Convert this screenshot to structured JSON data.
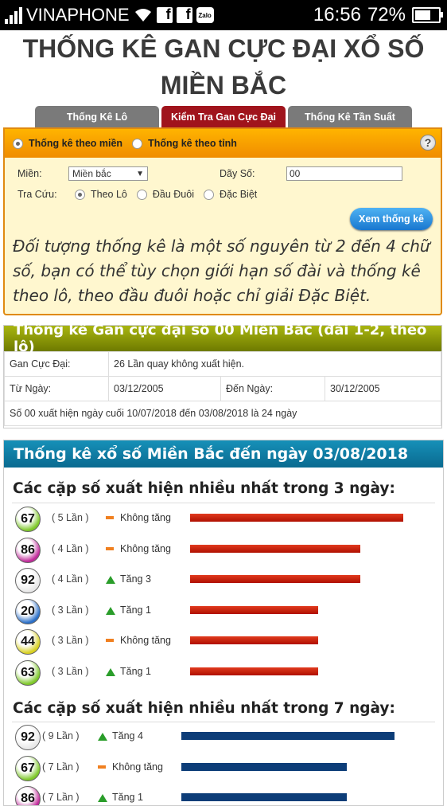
{
  "status": {
    "carrier": "VINAPHONE",
    "time": "16:56",
    "battery": "72%",
    "battery_level": 0.72,
    "icons": [
      "signal-icon",
      "wifi-icon",
      "facebook-icon",
      "facebook-icon",
      "zalo-icon",
      "battery-icon"
    ],
    "fb": "f",
    "zalo": "Zalo"
  },
  "page": {
    "title": "THỐNG KÊ GAN CỰC ĐẠI XỔ SỐ MIỀN BẮC"
  },
  "tabs": [
    {
      "label": "Thống Kê Lô"
    },
    {
      "label": "Kiểm Tra Gan Cực Đại"
    },
    {
      "label": "Thống Kê Tần Suất"
    }
  ],
  "form": {
    "mode_region": "Thống kê theo miền",
    "mode_province": "Thống kê theo tỉnh",
    "help": "?",
    "mien_label": "Miền:",
    "mien_value": "Miền bắc",
    "dayso_label": "Dãy Số:",
    "dayso_value": "00",
    "tracuu_label": "Tra Cứu:",
    "opt_lo": "Theo Lô",
    "opt_dau": "Đầu Đuôi",
    "opt_db": "Đặc Biệt",
    "view_button": "Xem thống kê",
    "description": "Đối tượng thống kê là một số nguyên từ 2 đến 4 chữ số, bạn có thể tùy chọn giới hạn số đài và thống kê theo lô, theo đầu đuôi hoặc chỉ giải Đặc Biệt."
  },
  "gan": {
    "title": "Thống kê Gan cực đại số 00 Miền Bắc (đài 1-2, theo lô)",
    "max_label": "Gan Cực Đại:",
    "max_value": "26 Lần quay không xuất hiện.",
    "from_label": "Từ Ngày:",
    "from_value": "03/12/2005",
    "to_label": "Đến Ngày:",
    "to_value": "30/12/2005",
    "note": "Số 00 xuất hiện ngày cuối 10/07/2018 đến 03/08/2018 là 24 ngày"
  },
  "stats": {
    "title": "Thống kê xổ số Miền Bắc đến ngày 03/08/2018",
    "sec3_title": "Các cặp số xuất hiện nhiều nhất trong 3 ngày:",
    "sec3": [
      {
        "num": "67",
        "count": "( 5 Lần )",
        "count_value": 5,
        "trend": "Không tăng",
        "dir": "flat",
        "color": "#7ec82a"
      },
      {
        "num": "86",
        "count": "( 4 Lần )",
        "count_value": 4,
        "trend": "Không tăng",
        "dir": "flat",
        "color": "#c02a9a"
      },
      {
        "num": "92",
        "count": "( 4 Lần )",
        "count_value": 4,
        "trend": "Tăng 3",
        "dir": "up",
        "color": "#e8e8e8"
      },
      {
        "num": "20",
        "count": "( 3 Lần )",
        "count_value": 3,
        "trend": "Tăng 1",
        "dir": "up",
        "color": "#2a6fc8"
      },
      {
        "num": "44",
        "count": "( 3 Lần )",
        "count_value": 3,
        "trend": "Không tăng",
        "dir": "flat",
        "color": "#d8d020"
      },
      {
        "num": "63",
        "count": "( 3 Lần )",
        "count_value": 3,
        "trend": "Tăng 1",
        "dir": "up",
        "color": "#7ec82a"
      }
    ],
    "sec7_title": "Các cặp số xuất hiện nhiều nhất trong 7 ngày:",
    "sec7": [
      {
        "num": "92",
        "count": "( 9 Lần )",
        "count_value": 9,
        "trend": "Tăng 4",
        "dir": "up",
        "color": "#e8e8e8"
      },
      {
        "num": "67",
        "count": "( 7 Lần )",
        "count_value": 7,
        "trend": "Không tăng",
        "dir": "flat",
        "color": "#7ec82a"
      },
      {
        "num": "86",
        "count": "( 7 Lần )",
        "count_value": 7,
        "trend": "Tăng 1",
        "dir": "up",
        "color": "#c02a9a"
      }
    ]
  }
}
